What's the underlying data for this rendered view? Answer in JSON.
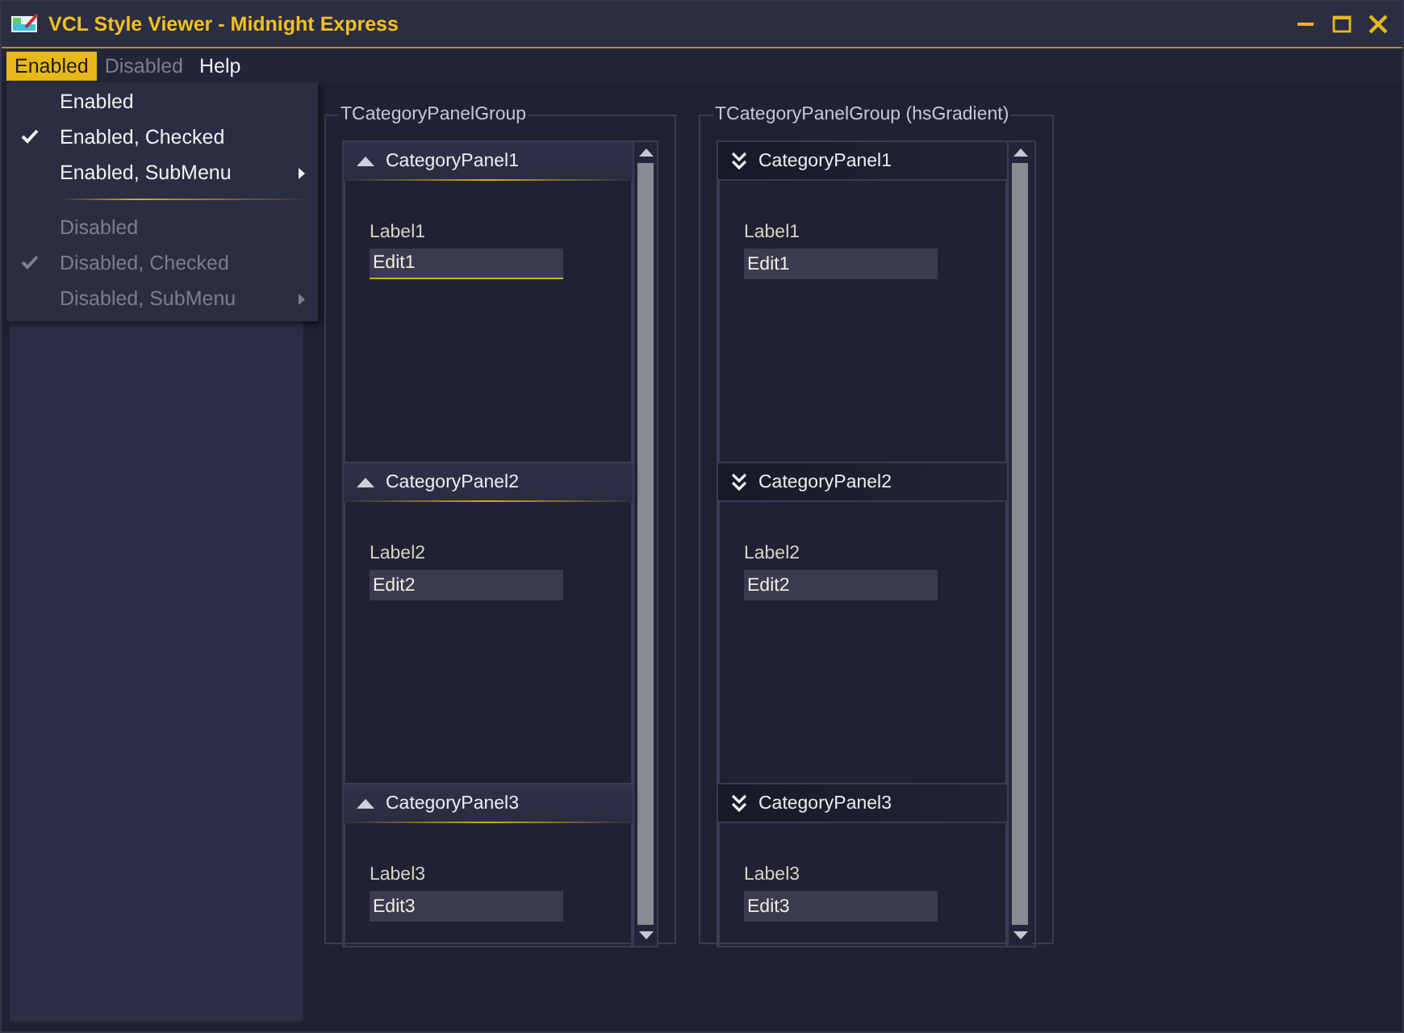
{
  "window": {
    "title": "VCL Style Viewer - Midnight Express"
  },
  "menubar": [
    {
      "label": "Enabled",
      "selected": true,
      "disabled": false
    },
    {
      "label": "Disabled",
      "selected": false,
      "disabled": true
    },
    {
      "label": "Help",
      "selected": false,
      "disabled": false
    }
  ],
  "menu": [
    {
      "kind": "item",
      "label": "Enabled",
      "checked": false,
      "disabled": false,
      "submenu": false
    },
    {
      "kind": "item",
      "label": "Enabled, Checked",
      "checked": true,
      "disabled": false,
      "submenu": false
    },
    {
      "kind": "item",
      "label": "Enabled, SubMenu",
      "checked": false,
      "disabled": false,
      "submenu": true
    },
    {
      "kind": "separator"
    },
    {
      "kind": "item",
      "label": "Disabled",
      "checked": false,
      "disabled": true,
      "submenu": false
    },
    {
      "kind": "item",
      "label": "Disabled, Checked",
      "checked": true,
      "disabled": true,
      "submenu": false
    },
    {
      "kind": "item",
      "label": "Disabled, SubMenu",
      "checked": false,
      "disabled": true,
      "submenu": true
    }
  ],
  "groups": [
    {
      "title": "TCategoryPanelGroup",
      "kind": "standard",
      "panels": [
        {
          "caption": "CategoryPanel1",
          "expanded": true,
          "label": "Label1",
          "edit": "Edit1"
        },
        {
          "caption": "CategoryPanel2",
          "expanded": true,
          "label": "Label2",
          "edit": "Edit2"
        },
        {
          "caption": "CategoryPanel3",
          "expanded": true,
          "label": "Label3",
          "edit": "Edit3"
        }
      ]
    },
    {
      "title": "TCategoryPanelGroup (hsGradient)",
      "kind": "gradient",
      "panels": [
        {
          "caption": "CategoryPanel1",
          "expanded": true,
          "label": "Label1",
          "edit": "Edit1"
        },
        {
          "caption": "CategoryPanel2",
          "expanded": true,
          "label": "Label2",
          "edit": "Edit2"
        },
        {
          "caption": "CategoryPanel3",
          "expanded": true,
          "label": "Label3",
          "edit": "Edit3"
        }
      ]
    }
  ]
}
